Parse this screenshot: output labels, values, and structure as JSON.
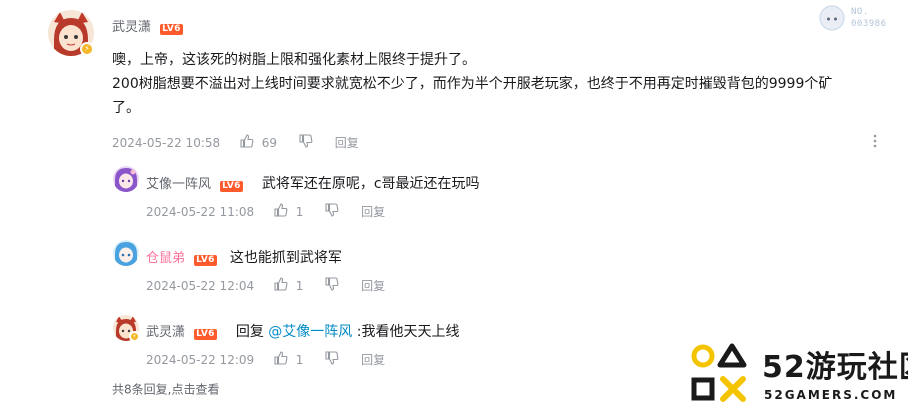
{
  "comments": [
    {
      "user": "武灵潇",
      "level": "LV6",
      "content_line1": "噢，上帝，这该死的树脂上限和强化素材上限终于提升了。",
      "content_line2": "200树脂想要不溢出对上线时间要求就宽松不少了，而作为半个开服老玩家，也终于不用再定时摧毁背包的9999个矿",
      "content_line3": "了。",
      "date": "2024-05-22 10:58",
      "likes": "69",
      "reply_label": "回复"
    }
  ],
  "replies": [
    {
      "user": "艾像一阵风",
      "level": "LV6",
      "content": "武将军还在原呢，c哥最近还在玩吗",
      "date": "2024-05-22 11:08",
      "likes": "1",
      "reply_label": "回复"
    },
    {
      "user": "仓鼠弟",
      "level": "LV6",
      "content": "这也能抓到武将军",
      "date": "2024-05-22 12:04",
      "likes": "1",
      "reply_label": "回复"
    },
    {
      "user": "武灵潇",
      "level": "LV6",
      "reply_prefix": "回复 ",
      "mention": "@艾像一阵风",
      "content": " :我看他天天上线",
      "date": "2024-05-22 12:09",
      "likes": "1",
      "reply_label": "回复"
    }
  ],
  "footer": {
    "summary": "共8条回复,",
    "action": "点击查看"
  },
  "fan_badge": {
    "label": "NO.",
    "number": "003986"
  },
  "watermark": {
    "title_num": "52",
    "title_cn": "游玩社区",
    "domain": "52GAMERS.COM"
  },
  "icons": {
    "like": "thumbs-up-icon",
    "dislike": "thumbs-down-icon",
    "more": "more-vertical-icon"
  },
  "colors": {
    "level_badge": "#ff5a2b",
    "username_pink": "#fb7299",
    "mention": "#008ac5",
    "meta": "#9499a0",
    "watermark_yellow": "#f5c400"
  }
}
